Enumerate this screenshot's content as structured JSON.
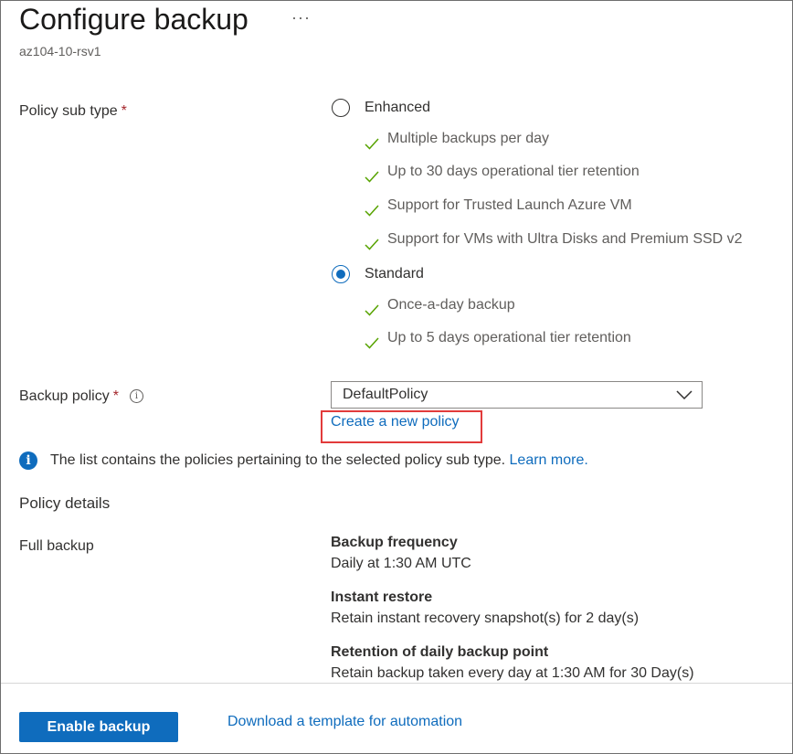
{
  "header": {
    "title": "Configure backup",
    "more_label": "···",
    "subtitle": "az104-10-rsv1"
  },
  "policy_sub_type": {
    "label": "Policy sub type",
    "required_mark": "*",
    "options": [
      {
        "label": "Enhanced",
        "selected": false,
        "features": [
          "Multiple backups per day",
          "Up to 30 days operational tier retention",
          "Support for Trusted Launch Azure VM",
          "Support for VMs with Ultra Disks and Premium SSD v2"
        ]
      },
      {
        "label": "Standard",
        "selected": true,
        "features": [
          "Once-a-day backup",
          "Up to 5 days operational tier retention"
        ]
      }
    ]
  },
  "backup_policy": {
    "label": "Backup policy",
    "required_mark": "*",
    "info_glyph": "i",
    "selected_value": "DefaultPolicy",
    "create_link": "Create a new policy"
  },
  "info_banner": {
    "glyph": "i",
    "text": "The list contains the policies pertaining to the selected policy sub type.",
    "link": "Learn more."
  },
  "policy_details": {
    "heading": "Policy details",
    "section_label": "Full backup",
    "items": [
      {
        "title": "Backup frequency",
        "text": "Daily at 1:30 AM UTC"
      },
      {
        "title": "Instant restore",
        "text": "Retain instant recovery snapshot(s) for 2 day(s)"
      },
      {
        "title": "Retention of daily backup point",
        "text": "Retain backup taken every day at 1:30 AM for 30 Day(s)"
      }
    ]
  },
  "footer": {
    "enable_button": "Enable backup",
    "template_link": "Download a template for automation"
  },
  "colors": {
    "accent": "#0f6cbd",
    "check_green": "#57a300",
    "highlight_red": "#e23b3b",
    "required_red": "#a4262c"
  },
  "icons": {
    "check": "checkmark-icon",
    "chevron": "chevron-down-icon",
    "info": "info-icon",
    "more": "more-ellipsis-icon"
  }
}
